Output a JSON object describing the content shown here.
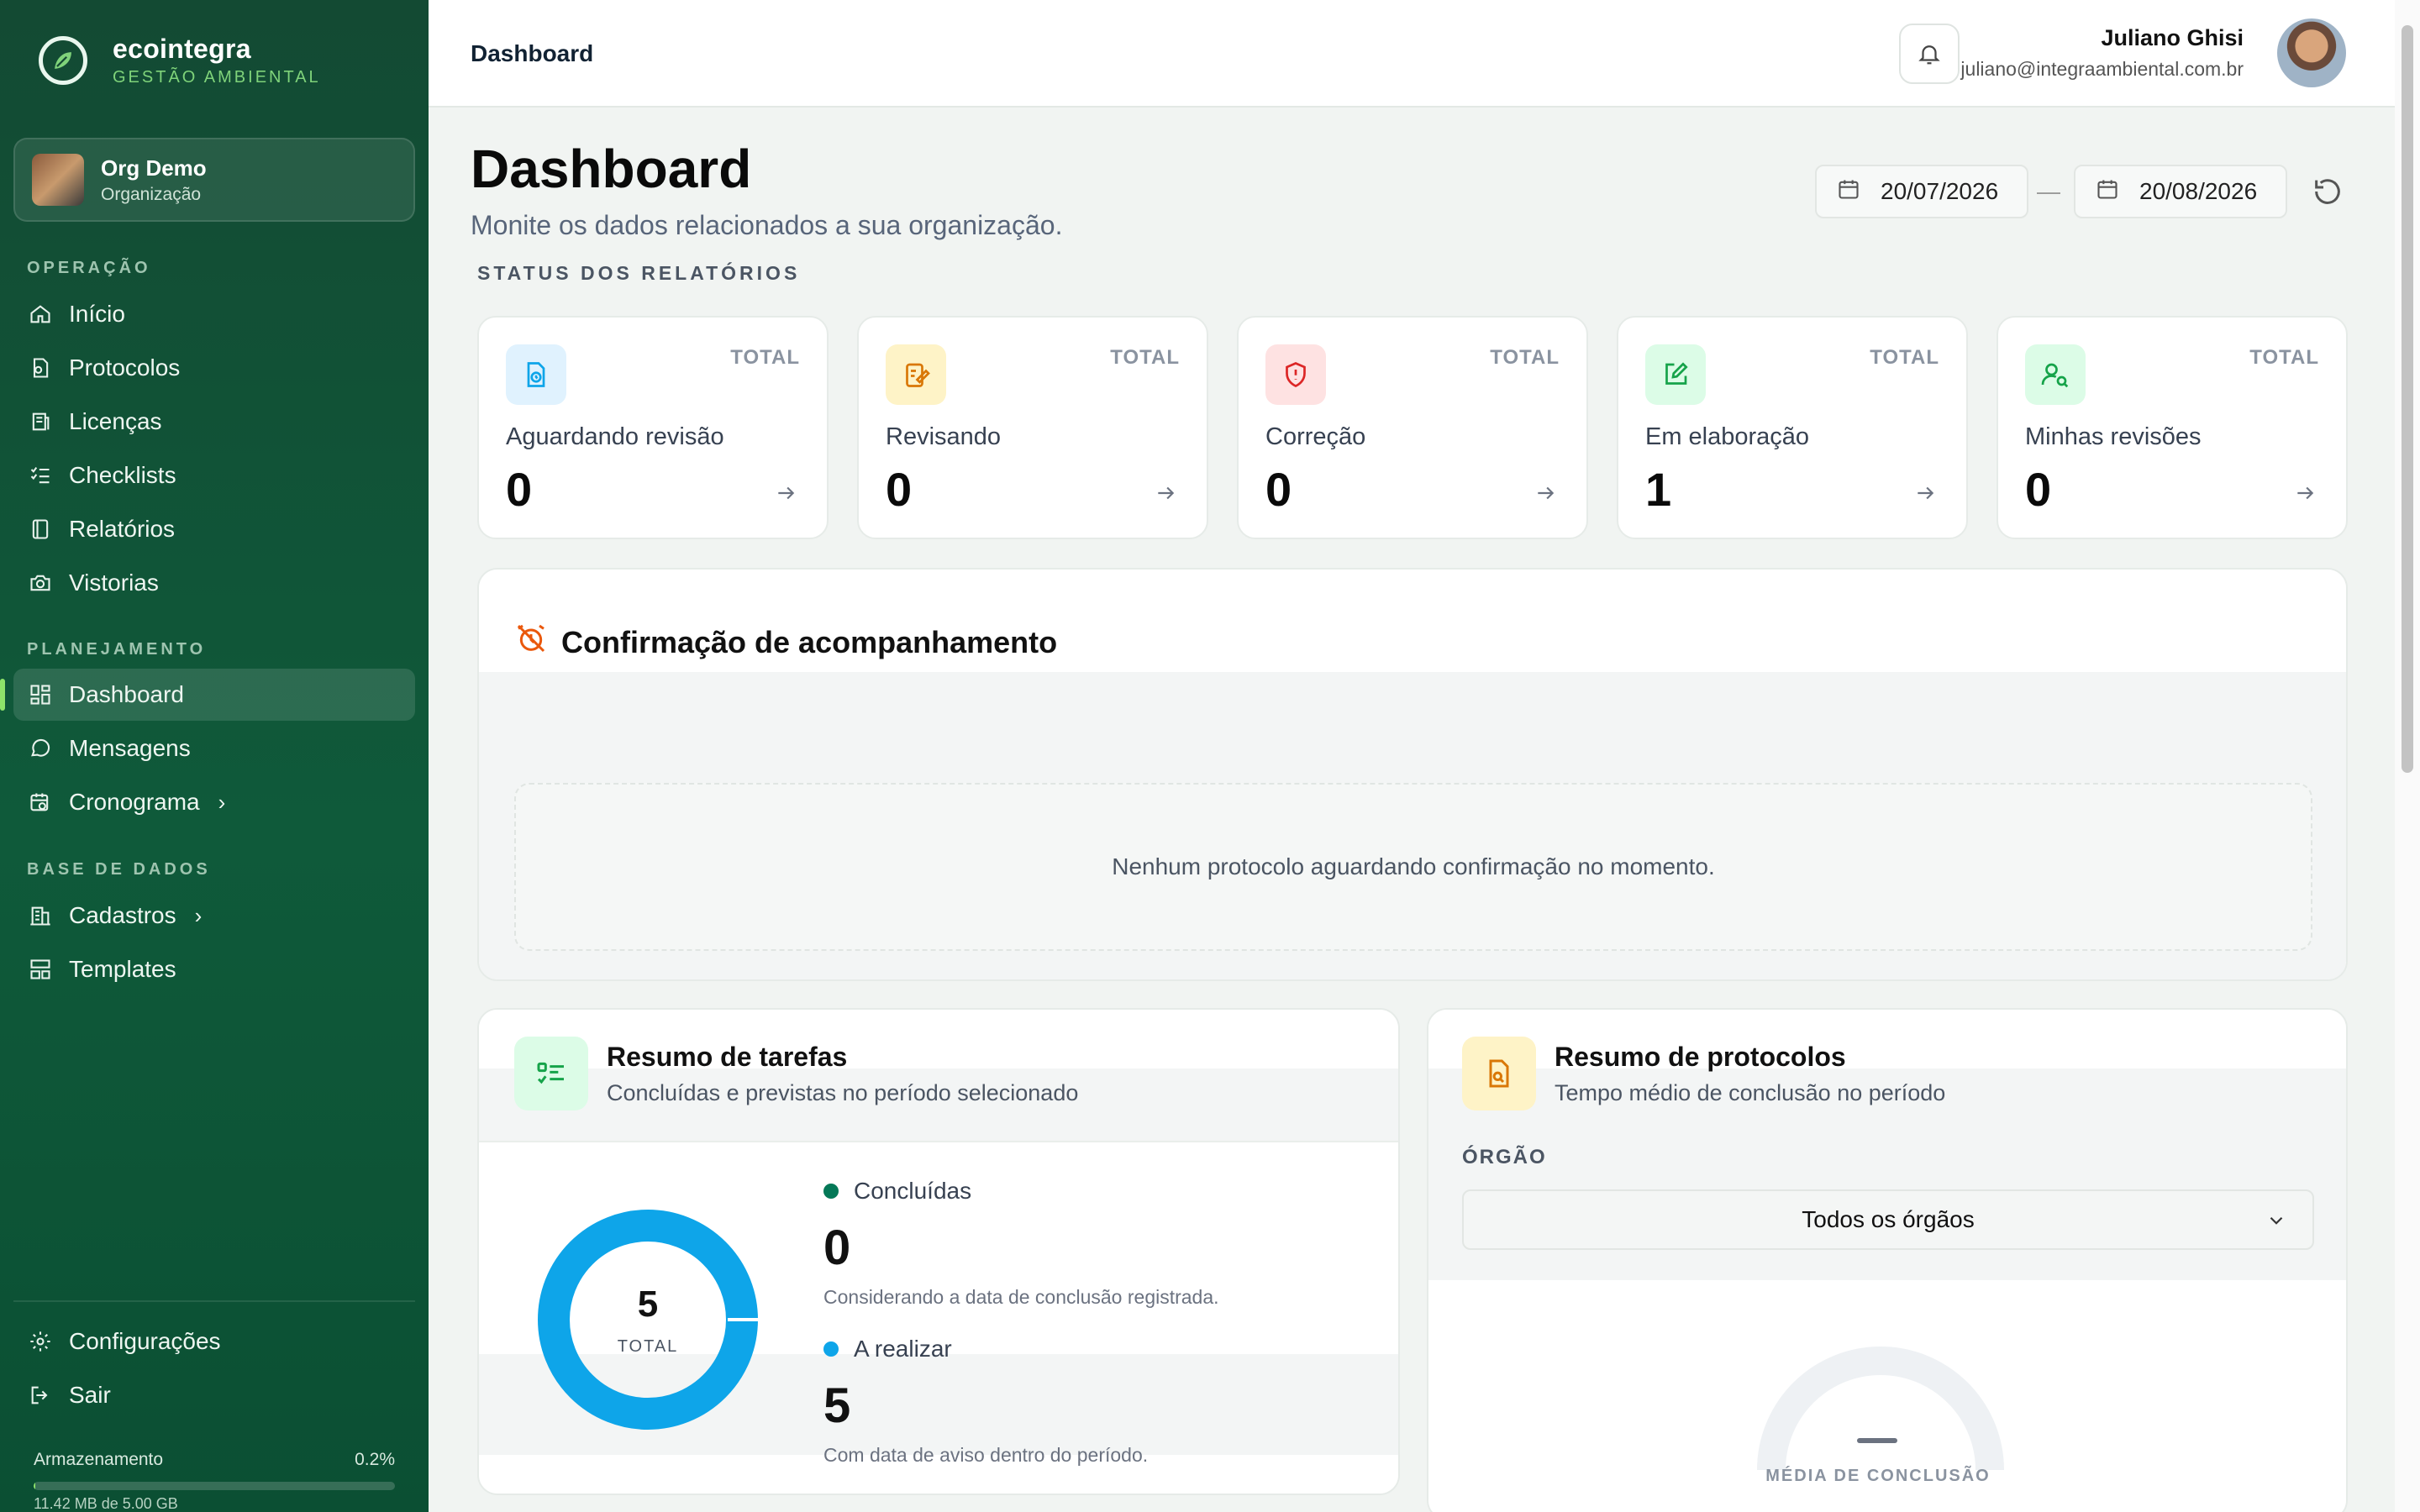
{
  "sidebar": {
    "brand_name": "ecointegra",
    "brand_sub": "GESTÃO AMBIENTAL",
    "org_name": "Org Demo",
    "org_role": "Organização",
    "sections": {
      "operacao": "OPERAÇÃO",
      "planejamento": "PLANEJAMENTO",
      "base": "BASE DE DADOS"
    },
    "items": [
      {
        "label": "Início",
        "icon": "home-icon"
      },
      {
        "label": "Protocolos",
        "icon": "protocol-icon"
      },
      {
        "label": "Licenças",
        "icon": "license-icon"
      },
      {
        "label": "Checklists",
        "icon": "checklist-icon"
      },
      {
        "label": "Relatórios",
        "icon": "report-icon"
      },
      {
        "label": "Vistorias",
        "icon": "camera-icon"
      },
      {
        "label": "Dashboard",
        "icon": "dashboard-icon",
        "active": true
      },
      {
        "label": "Mensagens",
        "icon": "message-icon"
      },
      {
        "label": "Cronograma",
        "icon": "calendar-clock-icon"
      },
      {
        "label": "Cadastros",
        "icon": "building-icon"
      },
      {
        "label": "Templates",
        "icon": "template-icon"
      },
      {
        "label": "Configurações",
        "icon": "gear-icon"
      },
      {
        "label": "Sair",
        "icon": "logout-icon"
      }
    ],
    "storage": {
      "label": "Armazenamento",
      "percent": "0.2%",
      "fill_percent": 0.2,
      "detail": "11.42 MB de 5.00 GB"
    }
  },
  "topbar": {
    "breadcrumb": "Dashboard",
    "user_name": "Juliano Ghisi",
    "user_email": "juliano@integraambiental.com.br"
  },
  "main": {
    "title": "Dashboard",
    "subtitle": "Monite os dados relacionados a sua organização.",
    "date_start": "20/07/2026",
    "date_sep": "—",
    "date_end": "20/08/2026",
    "status_title": "STATUS DOS RELATÓRIOS",
    "cards": [
      {
        "label": "Aguardando revisão",
        "total": "TOTAL",
        "value": "0",
        "icon": "clock-file-icon",
        "color": "#0ea5e9",
        "bg": "#e0f2fe"
      },
      {
        "label": "Revisando",
        "total": "TOTAL",
        "value": "0",
        "icon": "edit-notes-icon",
        "color": "#d97706",
        "bg": "#fef3c7"
      },
      {
        "label": "Correção",
        "total": "TOTAL",
        "value": "0",
        "icon": "shield-alert-icon",
        "color": "#dc2626",
        "bg": "#fee2e2"
      },
      {
        "label": "Em elaboração",
        "total": "TOTAL",
        "value": "1",
        "icon": "pencil-square-icon",
        "color": "#16a34a",
        "bg": "#dcfce7"
      },
      {
        "label": "Minhas revisões",
        "total": "TOTAL",
        "value": "0",
        "icon": "user-search-icon",
        "color": "#16a34a",
        "bg": "#dcfce7"
      }
    ],
    "confirm": {
      "title": "Confirmação de acompanhamento",
      "empty": "Nenhum protocolo aguardando confirmação no momento."
    },
    "tasks": {
      "title": "Resumo de tarefas",
      "subtitle": "Concluídas e previstas no período selecionado",
      "total": "5",
      "total_label": "TOTAL",
      "done_label": "Concluídas",
      "done_value": "0",
      "done_note": "Considerando a data de conclusão registrada.",
      "todo_label": "A realizar",
      "todo_value": "5",
      "todo_note": "Com data de aviso dentro do período.",
      "done_color": "#047857",
      "todo_color": "#0ea5e9"
    },
    "protocols": {
      "title": "Resumo de protocolos",
      "subtitle": "Tempo médio de conclusão no período",
      "orgao_label": "ÓRGÃO",
      "orgao_value": "Todos os órgãos",
      "gauge_label": "MÉDIA DE CONCLUSÃO"
    }
  }
}
